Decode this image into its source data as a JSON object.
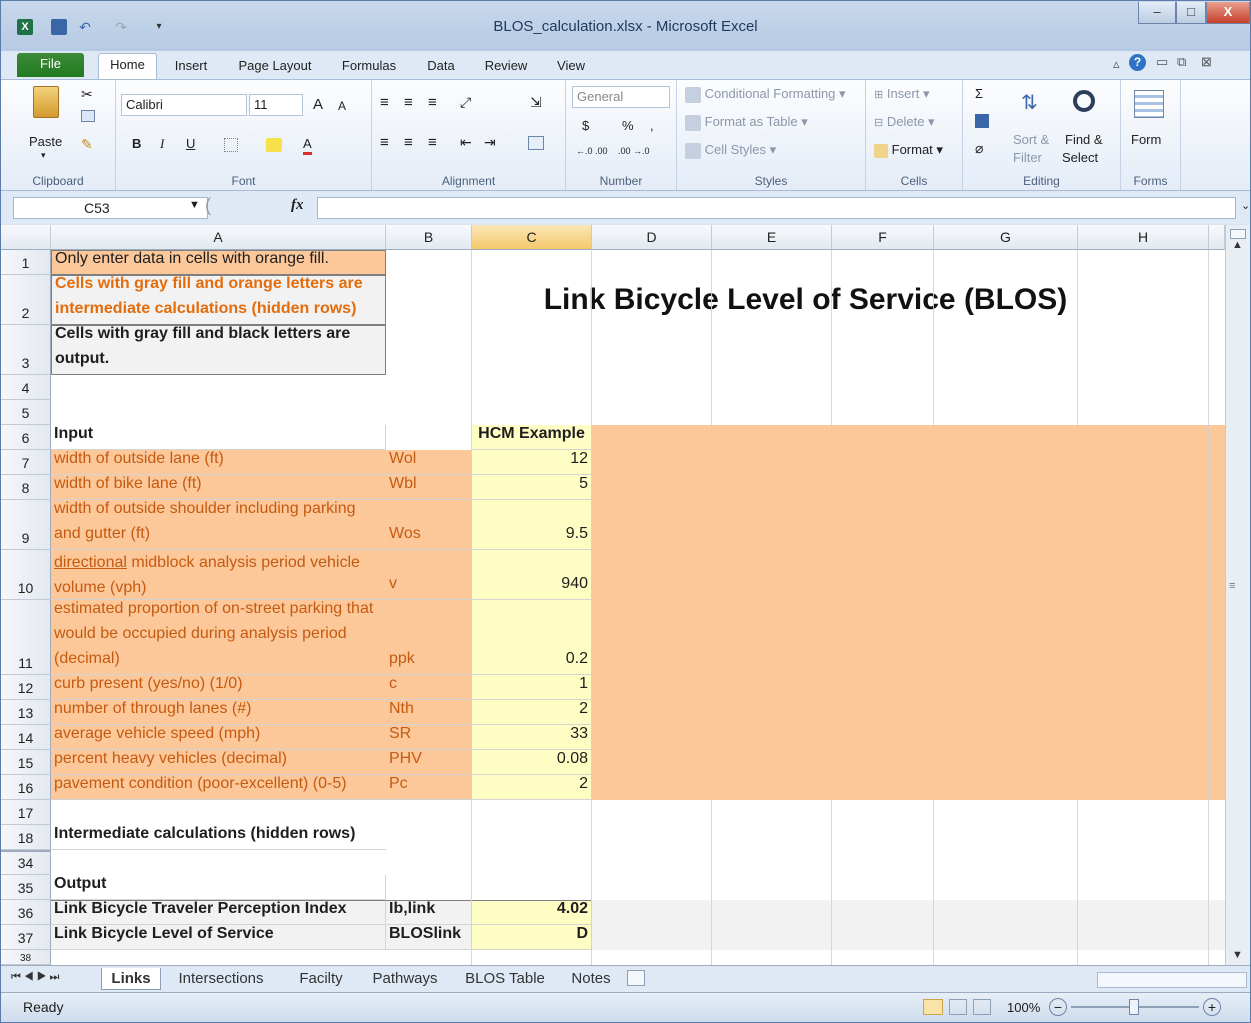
{
  "window": {
    "title": "BLOS_calculation.xlsx - Microsoft Excel",
    "minimize": "–",
    "maximize": "□",
    "close": "X"
  },
  "ribbon_tabs": [
    "File",
    "Home",
    "Insert",
    "Page Layout",
    "Formulas",
    "Data",
    "Review",
    "View"
  ],
  "ribbon": {
    "clipboard": {
      "label": "Clipboard",
      "paste": "Paste"
    },
    "font": {
      "label": "Font",
      "name": "Calibri",
      "size": "11",
      "bold": "B",
      "italic": "I",
      "underline": "U",
      "grow": "A",
      "shrink": "A",
      "color_a": "A"
    },
    "alignment": {
      "label": "Alignment"
    },
    "number": {
      "label": "Number",
      "format": "General",
      "currency": "$",
      "percent": "%",
      "comma": ",",
      "dec_inc": "←.0 .00",
      "dec_dec": ".00 →.0"
    },
    "styles": {
      "label": "Styles",
      "conditional": "Conditional Formatting",
      "format_table": "Format as Table",
      "cell_styles": "Cell Styles"
    },
    "cells": {
      "label": "Cells",
      "insert": "Insert",
      "delete": "Delete",
      "format": "Format"
    },
    "editing": {
      "label": "Editing",
      "sigma": "Σ",
      "sort": "Sort &",
      "filter": "Filter",
      "find": "Find &",
      "select": "Select"
    },
    "forms": {
      "label": "Forms",
      "form": "Form"
    }
  },
  "formula_bar": {
    "name_box": "C53",
    "fx": "fx",
    "formula": ""
  },
  "columns": [
    "A",
    "B",
    "C",
    "D",
    "E",
    "F",
    "G",
    "H"
  ],
  "rows": {
    "r1": {
      "num": "1",
      "a": "Only enter data in cells with orange fill."
    },
    "r2": {
      "num": "2",
      "a": "Cells with gray fill and orange letters are intermediate calculations (hidden rows)",
      "title": "Link Bicycle Level of Service (BLOS)"
    },
    "r3": {
      "num": "3",
      "a": "Cells with gray fill and black letters are output."
    },
    "r4": {
      "num": "4"
    },
    "r5": {
      "num": "5"
    },
    "r6": {
      "num": "6",
      "a": "Input",
      "c": "HCM Example"
    },
    "r7": {
      "num": "7",
      "a": "width of outside lane (ft)",
      "b": "Wol",
      "c": "12"
    },
    "r8": {
      "num": "8",
      "a": "width of bike lane (ft)",
      "b": "Wbl",
      "c": "5"
    },
    "r9": {
      "num": "9",
      "a": "width of outside shoulder including parking and gutter (ft)",
      "b": "Wos",
      "c": "9.5"
    },
    "r10": {
      "num": "10",
      "a_u": "directional",
      "a": " midblock analysis period vehicle volume (vph)",
      "b": "v",
      "c": "940"
    },
    "r11": {
      "num": "11",
      "a": "estimated proportion of on-street parking that would be occupied during analysis period (decimal)",
      "b": "ppk",
      "c": "0.2"
    },
    "r12": {
      "num": "12",
      "a": "curb present (yes/no) (1/0)",
      "b": "c",
      "c": "1"
    },
    "r13": {
      "num": "13",
      "a": "number of through lanes (#)",
      "b": "Nth",
      "c": "2"
    },
    "r14": {
      "num": "14",
      "a": "average vehicle speed (mph)",
      "b": "SR",
      "c": "33"
    },
    "r15": {
      "num": "15",
      "a": "percent heavy vehicles (decimal)",
      "b": "PHV",
      "c": "0.08"
    },
    "r16": {
      "num": "16",
      "a": "pavement condition (poor-excellent) (0-5)",
      "b": "Pc",
      "c": "2"
    },
    "r17": {
      "num": "17"
    },
    "r18": {
      "num": "18",
      "a": "Intermediate calculations (hidden rows)"
    },
    "r34": {
      "num": "34"
    },
    "r35": {
      "num": "35",
      "a": "Output"
    },
    "r36": {
      "num": "36",
      "a": "Link Bicycle Traveler Perception Index",
      "b": "Ib,link",
      "c": "4.02"
    },
    "r37": {
      "num": "37",
      "a": "Link Bicycle Level of Service",
      "b": "BLOSlink",
      "c": "D"
    },
    "r38": {
      "num": "38"
    }
  },
  "sheet_tabs": [
    "Links",
    "Intersections",
    "Facilty",
    "Pathways",
    "BLOS Table",
    "Notes"
  ],
  "status": {
    "ready": "Ready",
    "zoom": "100%"
  },
  "colors": {
    "orange_fill": "#fcc89a",
    "yellow_fill": "#fefdc4",
    "gray_fill": "#f2f2f2",
    "orange_text": "#e46c0a",
    "selected_col": "#f9d99a"
  }
}
